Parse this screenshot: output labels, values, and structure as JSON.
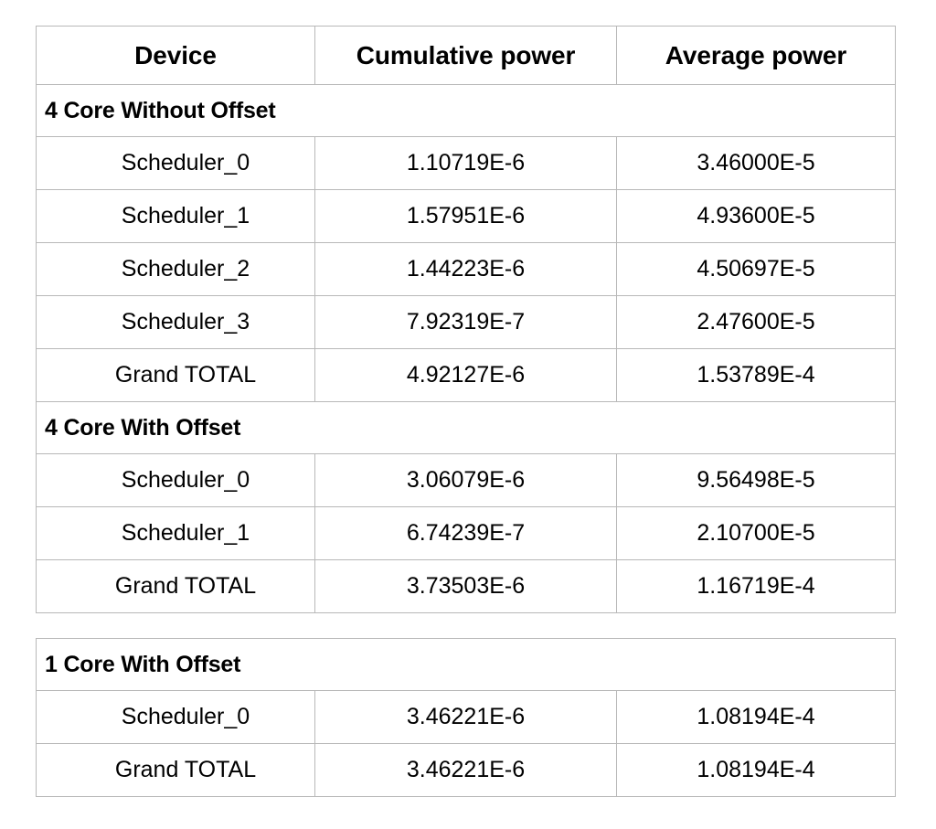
{
  "table_one": {
    "columns": [
      "Device",
      "Cumulative power",
      "Average power"
    ],
    "sections": [
      {
        "title": "4 Core Without Offset",
        "rows": [
          {
            "device": "Scheduler_0",
            "cumulative": "1.10719E-6",
            "average": "3.46000E-5"
          },
          {
            "device": "Scheduler_1",
            "cumulative": "1.57951E-6",
            "average": "4.93600E-5"
          },
          {
            "device": "Scheduler_2",
            "cumulative": "1.44223E-6",
            "average": "4.50697E-5"
          },
          {
            "device": "Scheduler_3",
            "cumulative": "7.92319E-7",
            "average": "2.47600E-5"
          },
          {
            "device": "Grand TOTAL",
            "cumulative": "4.92127E-6",
            "average": "1.53789E-4"
          }
        ]
      },
      {
        "title": "4 Core With Offset",
        "rows": [
          {
            "device": "Scheduler_0",
            "cumulative": "3.06079E-6",
            "average": "9.56498E-5"
          },
          {
            "device": "Scheduler_1",
            "cumulative": "6.74239E-7",
            "average": "2.10700E-5"
          },
          {
            "device": "Grand TOTAL",
            "cumulative": "3.73503E-6",
            "average": "1.16719E-4"
          }
        ]
      }
    ]
  },
  "table_two": {
    "sections": [
      {
        "title": "1 Core With Offset",
        "rows": [
          {
            "device": "Scheduler_0",
            "cumulative": "3.46221E-6",
            "average": "1.08194E-4"
          },
          {
            "device": "Grand TOTAL",
            "cumulative": "3.46221E-6",
            "average": "1.08194E-4"
          }
        ]
      }
    ]
  }
}
